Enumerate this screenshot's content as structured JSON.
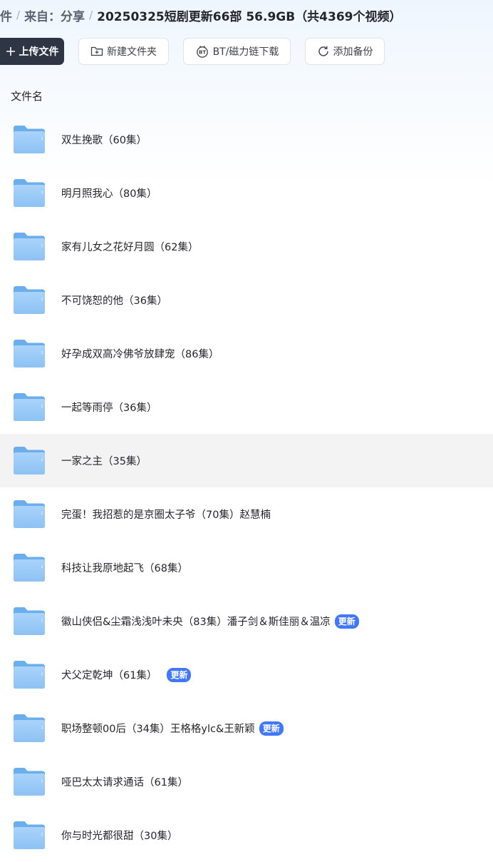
{
  "breadcrumb": {
    "items": [
      "件",
      "来自：分享"
    ],
    "current": "20250325短剧更新66部 56.9GB（共4369个视频）"
  },
  "toolbar": {
    "upload": {
      "label": "上传文件",
      "icon": "plus-icon"
    },
    "new_folder": {
      "label": "新建文件夹",
      "icon": "folder-plus-icon"
    },
    "bt": {
      "label": "BT/磁力链下载",
      "icon": "bt-icon"
    },
    "backup": {
      "label": "添加备份",
      "icon": "sync-icon"
    }
  },
  "list": {
    "column_header": "文件名",
    "badge_label": "更新",
    "items": [
      {
        "name": "双生挽歌（60集）",
        "badge": false
      },
      {
        "name": "明月照我心（80集）",
        "badge": false
      },
      {
        "name": "家有儿女之花好月圆（62集）",
        "badge": false
      },
      {
        "name": "不可饶恕的他（36集）",
        "badge": false
      },
      {
        "name": "好孕成双高冷佛爷放肆宠（86集）",
        "badge": false
      },
      {
        "name": "一起等雨停（36集）",
        "badge": false
      },
      {
        "name": "一家之主（35集）",
        "badge": false,
        "hovered": true
      },
      {
        "name": "完蛋！我招惹的是京圈太子爷（70集）赵慧楠",
        "badge": false
      },
      {
        "name": "科技让我原地起飞（68集）",
        "badge": false
      },
      {
        "name": "徽山侠侣&尘霜浅浅叶未央（83集）潘子剑＆斯佳丽＆温凉",
        "badge": true
      },
      {
        "name": "犬父定乾坤（61集）",
        "badge": true
      },
      {
        "name": "职场整顿00后（34集）王格格ylc&王新颖",
        "badge": true
      },
      {
        "name": "哑巴太太请求通话（61集）",
        "badge": false
      },
      {
        "name": "你与时光都很甜（30集）",
        "badge": false
      }
    ]
  },
  "colors": {
    "primary_button": "#2e3545",
    "badge": "#3f78ff",
    "folder": "#7db8f0",
    "hover_row": "#f3f3f3"
  }
}
